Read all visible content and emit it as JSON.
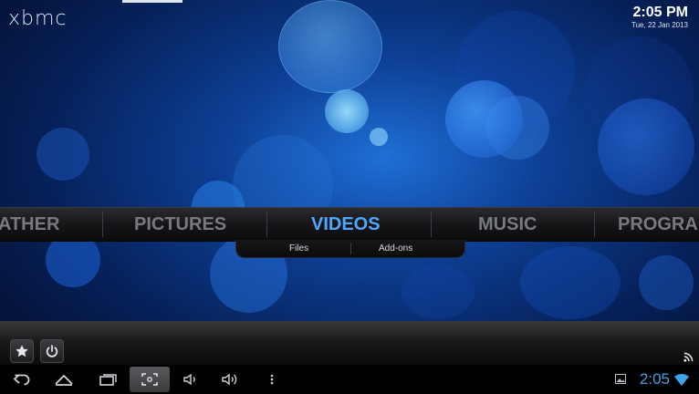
{
  "app": {
    "logo_text": "xbmc"
  },
  "clock": {
    "time": "2:05 PM",
    "date": "Tue, 22 Jan 2013"
  },
  "main_menu": {
    "items": [
      {
        "label": "ATHER"
      },
      {
        "label": "PICTURES"
      },
      {
        "label": "VIDEOS",
        "active": true
      },
      {
        "label": "MUSIC"
      },
      {
        "label": "PROGRA"
      }
    ],
    "active_color": "#4ea8ff"
  },
  "submenu": {
    "items": [
      {
        "label": "Files"
      },
      {
        "label": "Add-ons"
      }
    ]
  },
  "bottom_panel": {
    "favourites_icon": "star-icon",
    "power_icon": "power-icon",
    "rss_icon": "rss-icon"
  },
  "android_status": {
    "time": "2:05",
    "time_color": "#3ea3ea",
    "icons": [
      "back-icon",
      "home-icon",
      "recent-apps-icon",
      "screenshot-icon",
      "volume-down-icon",
      "volume-up-icon",
      "menu-icon",
      "gallery-icon",
      "wifi-icon"
    ]
  }
}
